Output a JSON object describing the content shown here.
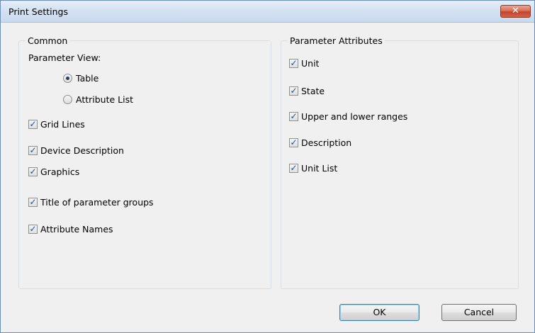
{
  "window": {
    "title": "Print Settings",
    "close_glyph": "✕"
  },
  "common": {
    "legend": "Common",
    "parameter_view_label": "Parameter View:",
    "radios": [
      {
        "label": "Table",
        "selected": true
      },
      {
        "label": "Attribute List",
        "selected": false
      }
    ],
    "checkboxes": [
      {
        "label": "Grid Lines",
        "checked": true
      },
      {
        "label": "Device Description",
        "checked": true
      },
      {
        "label": "Graphics",
        "checked": true
      },
      {
        "label": "Title of parameter groups",
        "checked": true
      },
      {
        "label": "Attribute Names",
        "checked": true
      }
    ]
  },
  "attributes": {
    "legend": "Parameter Attributes",
    "checkboxes": [
      {
        "label": "Unit",
        "checked": true
      },
      {
        "label": "State",
        "checked": true
      },
      {
        "label": "Upper and lower ranges",
        "checked": true
      },
      {
        "label": "Description",
        "checked": true
      },
      {
        "label": "Unit List",
        "checked": true
      }
    ]
  },
  "buttons": {
    "ok": "OK",
    "cancel": "Cancel"
  },
  "check_glyph": "✓"
}
